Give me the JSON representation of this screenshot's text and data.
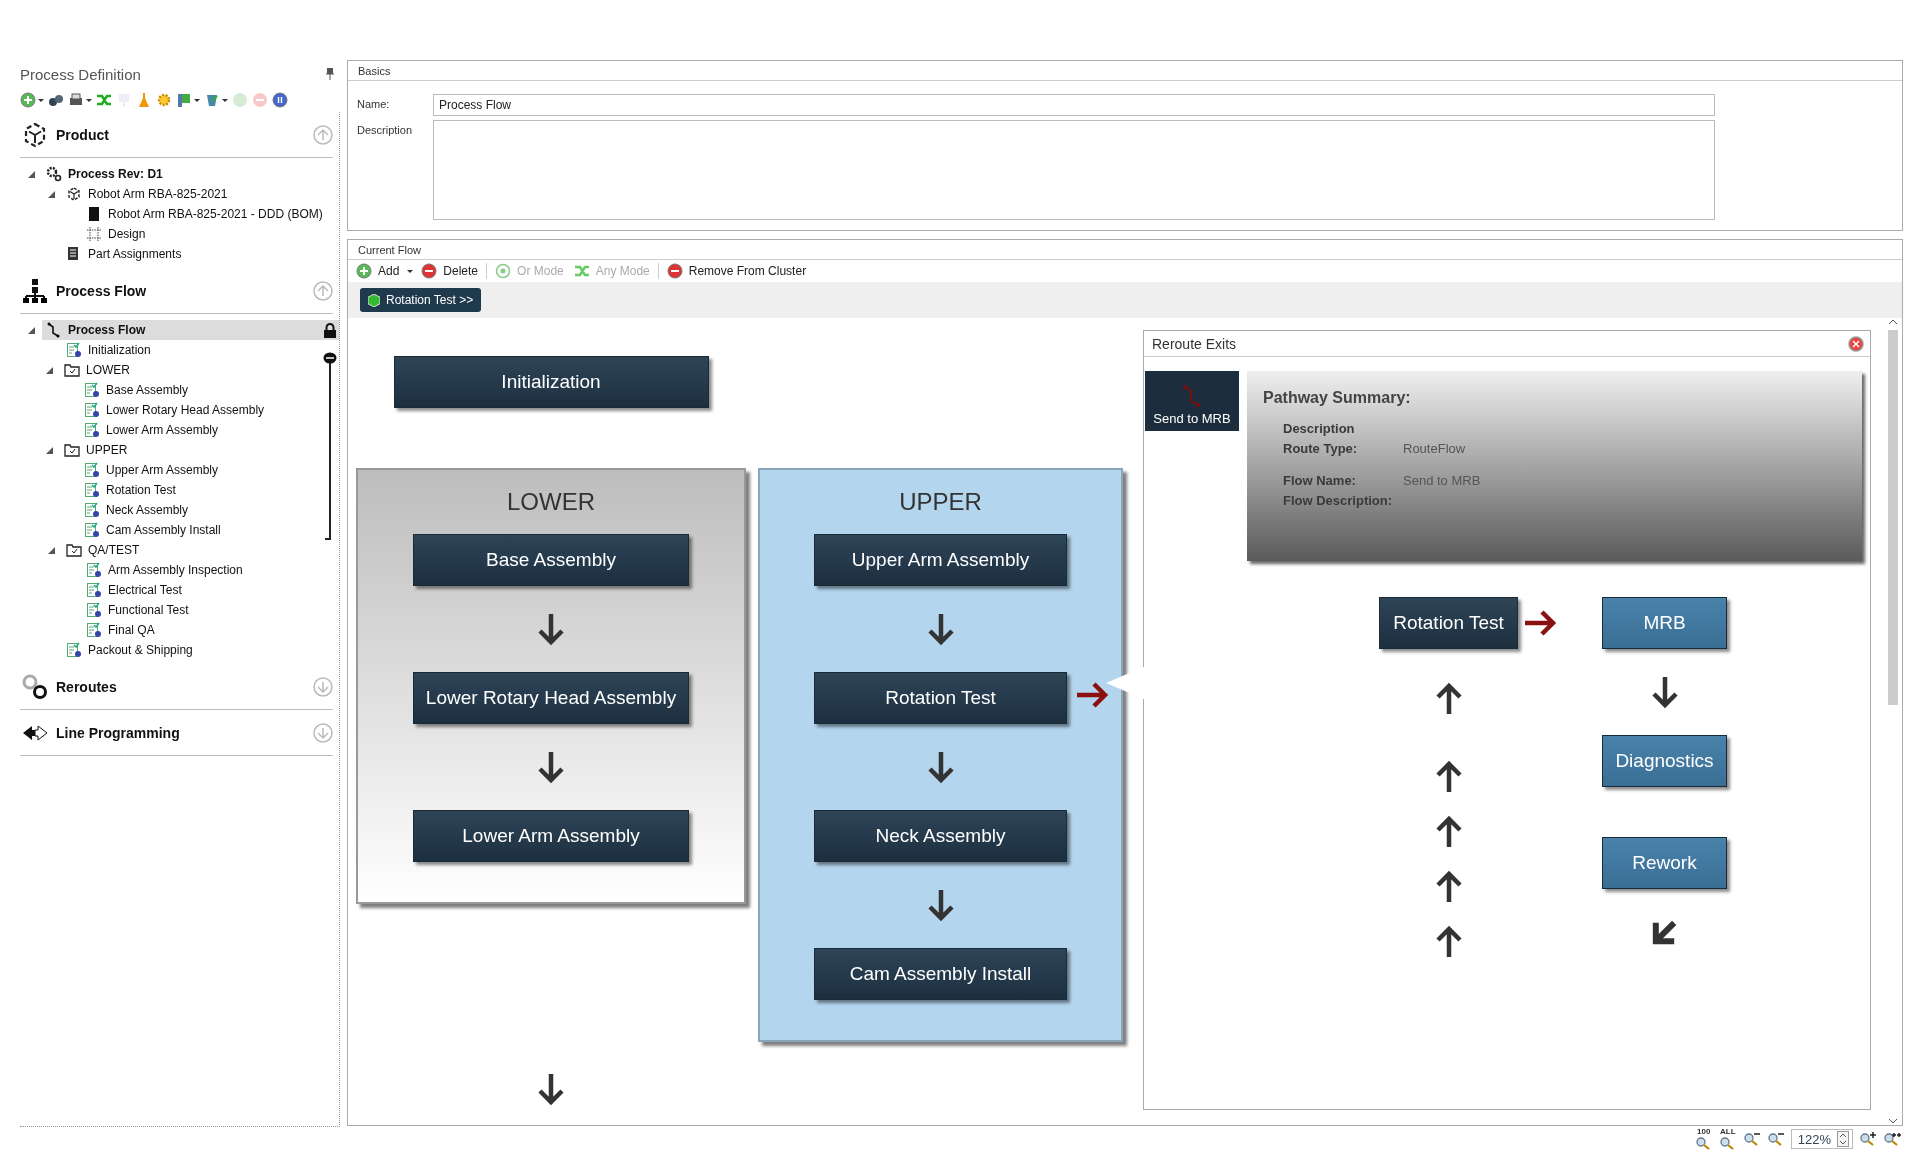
{
  "left_panel": {
    "title": "Process Definition",
    "toolbar": [
      {
        "kind": "add",
        "dropdown": true,
        "disabled": false
      },
      {
        "kind": "binoculars",
        "dropdown": false,
        "disabled": false
      },
      {
        "kind": "printer",
        "dropdown": true,
        "disabled": false
      },
      {
        "kind": "shuffle",
        "dropdown": false,
        "disabled": false
      },
      {
        "kind": "chart",
        "dropdown": false,
        "disabled": true
      },
      {
        "kind": "bottle",
        "dropdown": false,
        "disabled": false
      },
      {
        "kind": "gear",
        "dropdown": false,
        "disabled": false
      },
      {
        "kind": "flag",
        "dropdown": true,
        "disabled": false
      },
      {
        "kind": "cup",
        "dropdown": true,
        "disabled": false
      },
      {
        "kind": "refresh",
        "dropdown": false,
        "disabled": true
      },
      {
        "kind": "minus",
        "dropdown": false,
        "disabled": true
      },
      {
        "kind": "pause",
        "dropdown": false,
        "disabled": false
      }
    ],
    "sections": [
      {
        "title": "Product",
        "kind": "product",
        "expanded": true,
        "tree": [
          {
            "label": "Process Rev: D1",
            "kind": "process",
            "bold": true,
            "expanded": true,
            "selected": false,
            "children": [
              {
                "label": "Robot Arm RBA-825-2021",
                "kind": "product",
                "bold": false,
                "expanded": true,
                "selected": false,
                "children": [
                  {
                    "label": "Robot Arm RBA-825-2021 - DDD (BOM)",
                    "kind": "bom",
                    "bold": false,
                    "selected": false
                  },
                  {
                    "label": "Design",
                    "kind": "design",
                    "bold": false,
                    "selected": false
                  }
                ]
              },
              {
                "label": "Part Assignments",
                "kind": "assignments",
                "bold": false,
                "selected": false
              }
            ]
          }
        ]
      },
      {
        "title": "Process Flow",
        "kind": "flow",
        "expanded": true,
        "tree": [
          {
            "label": "Process Flow",
            "kind": "flow",
            "bold": true,
            "expanded": true,
            "selected": true,
            "locked": true,
            "children": [
              {
                "label": "Initialization",
                "kind": "step",
                "bold": false,
                "selected": false
              },
              {
                "label": "LOWER",
                "kind": "cluster",
                "bold": false,
                "expanded": true,
                "selected": false,
                "linked": true,
                "children": [
                  {
                    "label": "Base Assembly",
                    "kind": "step",
                    "bold": false,
                    "selected": false
                  },
                  {
                    "label": "Lower Rotary Head Assembly",
                    "kind": "step",
                    "bold": false,
                    "selected": false
                  },
                  {
                    "label": "Lower Arm Assembly",
                    "kind": "step",
                    "bold": false,
                    "selected": false
                  }
                ]
              },
              {
                "label": "UPPER",
                "kind": "cluster",
                "bold": false,
                "expanded": true,
                "selected": false,
                "linked": true,
                "children": [
                  {
                    "label": "Upper Arm Assembly",
                    "kind": "step",
                    "bold": false,
                    "selected": false
                  },
                  {
                    "label": "Rotation Test",
                    "kind": "step",
                    "bold": false,
                    "selected": false
                  },
                  {
                    "label": "Neck Assembly",
                    "kind": "step",
                    "bold": false,
                    "selected": false
                  },
                  {
                    "label": "Cam Assembly Install",
                    "kind": "step",
                    "bold": false,
                    "selected": false
                  }
                ]
              },
              {
                "label": "QA/TEST",
                "kind": "cluster",
                "bold": false,
                "expanded": true,
                "selected": false,
                "linked": false,
                "children": [
                  {
                    "label": "Arm Assembly Inspection",
                    "kind": "step",
                    "bold": false,
                    "selected": false
                  },
                  {
                    "label": "Electrical Test",
                    "kind": "step",
                    "bold": false,
                    "selected": false
                  },
                  {
                    "label": "Functional Test",
                    "kind": "step",
                    "bold": false,
                    "selected": false
                  },
                  {
                    "label": "Final QA",
                    "kind": "step",
                    "bold": false,
                    "selected": false
                  }
                ]
              },
              {
                "label": "Packout & Shipping",
                "kind": "step",
                "bold": false,
                "selected": false
              }
            ]
          }
        ]
      },
      {
        "title": "Reroutes",
        "kind": "reroutes",
        "expanded": false
      },
      {
        "title": "Line Programming",
        "kind": "line",
        "expanded": false
      }
    ]
  },
  "basics": {
    "title": "Basics",
    "name_label": "Name:",
    "name_value": "Process Flow",
    "description_label": "Description"
  },
  "current_flow": {
    "title": "Current Flow",
    "toolbar": [
      {
        "label": "Add",
        "kind": "add",
        "dropdown": true,
        "disabled": false,
        "separator_after": false
      },
      {
        "label": "Delete",
        "kind": "delete",
        "dropdown": false,
        "disabled": false,
        "separator_after": true
      },
      {
        "label": "Or Mode",
        "kind": "or",
        "dropdown": false,
        "disabled": true,
        "separator_after": false
      },
      {
        "label": "Any Mode",
        "kind": "any",
        "dropdown": false,
        "disabled": true,
        "separator_after": true
      },
      {
        "label": "Remove From Cluster",
        "kind": "remove",
        "dropdown": false,
        "disabled": false,
        "separator_after": false
      }
    ],
    "breadcrumb": "Rotation Test >>",
    "start_step": "Initialization",
    "clusters": [
      {
        "title": "LOWER",
        "selected": false,
        "steps": [
          {
            "label": "Base Assembly",
            "reroute": false
          },
          {
            "label": "Lower Rotary Head Assembly",
            "reroute": false
          },
          {
            "label": "Lower Arm Assembly",
            "reroute": false
          }
        ]
      },
      {
        "title": "UPPER",
        "selected": true,
        "steps": [
          {
            "label": "Upper Arm Assembly",
            "reroute": false
          },
          {
            "label": "Rotation Test",
            "reroute": true
          },
          {
            "label": "Neck Assembly",
            "reroute": false
          },
          {
            "label": "Cam Assembly Install",
            "reroute": false
          }
        ]
      }
    ],
    "zoom": {
      "value": "122%",
      "buttons": [
        {
          "kind": "fit",
          "label": "100"
        },
        {
          "kind": "all",
          "label": "ALL"
        },
        {
          "kind": "out-more"
        },
        {
          "kind": "out"
        }
      ],
      "after": [
        {
          "kind": "in"
        },
        {
          "kind": "in-more"
        }
      ]
    }
  },
  "reroute_panel": {
    "title": "Reroute Exits",
    "exits": [
      {
        "label": "Send to MRB",
        "selected": true
      }
    ],
    "summary": {
      "title": "Pathway Summary:",
      "field_groups": [
        [
          {
            "label": "Description"
          },
          {
            "label": "Route Type:",
            "value": "RouteFlow"
          }
        ],
        [
          {
            "label": "Flow Name:",
            "value": "Send to MRB"
          },
          {
            "label": "Flow Description:"
          }
        ]
      ]
    },
    "diagram": {
      "source": "Rotation Test",
      "targets": [
        "MRB",
        "Diagnostics",
        "Rework"
      ]
    }
  }
}
